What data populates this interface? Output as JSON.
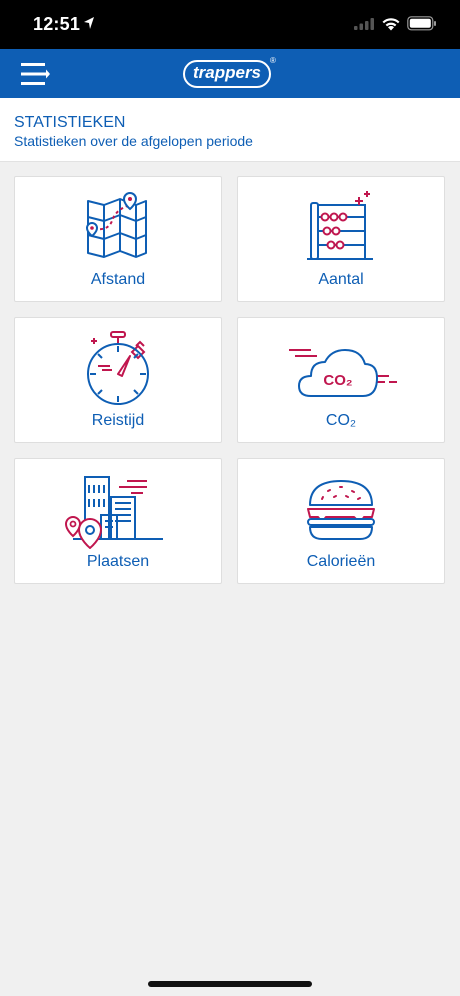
{
  "status_bar": {
    "time": "12:51"
  },
  "app_bar": {
    "logo_text": "trappers",
    "logo_mark": "®"
  },
  "header": {
    "title": "STATISTIEKEN",
    "subtitle": "Statistieken over de afgelopen periode"
  },
  "cards": [
    {
      "label": "Afstand",
      "icon": "map-icon"
    },
    {
      "label": "Aantal",
      "icon": "abacus-icon"
    },
    {
      "label": "Reistijd",
      "icon": "stopwatch-icon"
    },
    {
      "label": "CO₂",
      "icon": "co2-cloud-icon",
      "icon_text": "CO₂"
    },
    {
      "label": "Plaatsen",
      "icon": "city-buildings-icon"
    },
    {
      "label": "Calorieën",
      "icon": "burger-icon"
    }
  ],
  "colors": {
    "primary_blue": "#0e5eb4",
    "accent_pink": "#c0164e",
    "background": "#f0f0f0"
  }
}
